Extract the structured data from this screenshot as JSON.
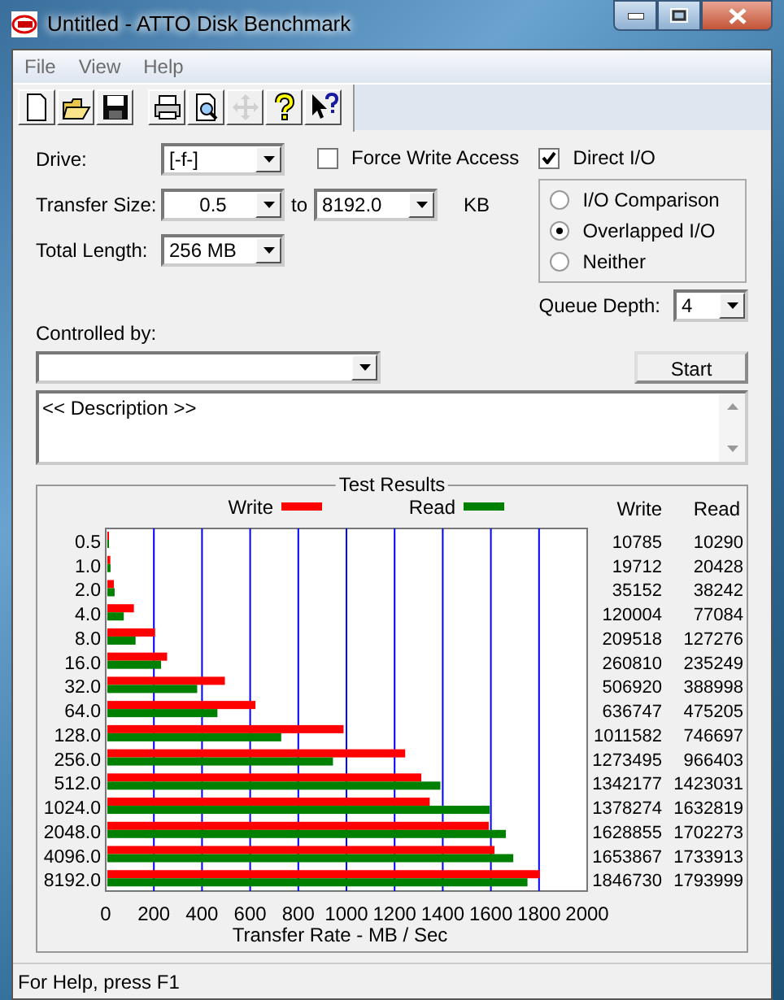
{
  "window": {
    "title": "Untitled - ATTO Disk Benchmark"
  },
  "menu": [
    {
      "label": "File"
    },
    {
      "label": "View"
    },
    {
      "label": "Help"
    }
  ],
  "toolbar": [
    {
      "kind": "new",
      "disabled": false
    },
    {
      "kind": "open",
      "disabled": false
    },
    {
      "kind": "save",
      "disabled": false
    },
    {
      "kind": "sep"
    },
    {
      "kind": "print",
      "disabled": false
    },
    {
      "kind": "preview",
      "disabled": false
    },
    {
      "kind": "move",
      "disabled": true
    },
    {
      "kind": "help",
      "disabled": false
    },
    {
      "kind": "context-help",
      "disabled": false
    }
  ],
  "form": {
    "drive": {
      "label": "Drive:",
      "value": "[-f-]"
    },
    "force_write_access": {
      "label": "Force Write Access",
      "checked": false
    },
    "direct_io": {
      "label": "Direct I/O",
      "checked": true
    },
    "transfer_size": {
      "label": "Transfer Size:",
      "from": "0.5",
      "to_label": "to",
      "to": "8192.0",
      "unit": "KB"
    },
    "total_length": {
      "label": "Total Length:",
      "value": "256 MB"
    },
    "io_modes": [
      {
        "label": "I/O Comparison",
        "selected": false
      },
      {
        "label": "Overlapped I/O",
        "selected": true
      },
      {
        "label": "Neither",
        "selected": false
      }
    ],
    "queue_depth": {
      "label": "Queue Depth:",
      "value": "4"
    },
    "controlled_by": {
      "label": "Controlled by:"
    },
    "start_button": "Start",
    "description": "<< Description >>"
  },
  "results": {
    "title": "Test Results",
    "chart_data": {
      "type": "bar",
      "orientation": "horizontal",
      "grid": true,
      "legend": "top",
      "xlabel": "Transfer Rate - MB / Sec",
      "xlim": [
        0,
        2000
      ],
      "xticks": [
        0,
        200,
        400,
        600,
        800,
        1000,
        1200,
        1400,
        1600,
        1800,
        2000
      ],
      "categories": [
        "0.5",
        "1.0",
        "2.0",
        "4.0",
        "8.0",
        "16.0",
        "32.0",
        "64.0",
        "128.0",
        "256.0",
        "512.0",
        "1024.0",
        "2048.0",
        "4096.0",
        "8192.0"
      ],
      "series": [
        {
          "name": "Write",
          "color": "#ff0000",
          "values": [
            11,
            19,
            34,
            117,
            205,
            255,
            495,
            622,
            988,
            1244,
            1311,
            1346,
            1591,
            1615,
            1803
          ]
        },
        {
          "name": "Read",
          "color": "#008000",
          "values": [
            10,
            20,
            37,
            75,
            124,
            230,
            380,
            464,
            729,
            944,
            1390,
            1595,
            1662,
            1693,
            1752
          ]
        }
      ]
    },
    "table": {
      "columns": [
        "Write",
        "Read"
      ],
      "rows": [
        [
          "10785",
          "10290"
        ],
        [
          "19712",
          "20428"
        ],
        [
          "35152",
          "38242"
        ],
        [
          "120004",
          "77084"
        ],
        [
          "209518",
          "127276"
        ],
        [
          "260810",
          "235249"
        ],
        [
          "506920",
          "388998"
        ],
        [
          "636747",
          "475205"
        ],
        [
          "1011582",
          "746697"
        ],
        [
          "1273495",
          "966403"
        ],
        [
          "1342177",
          "1423031"
        ],
        [
          "1378274",
          "1632819"
        ],
        [
          "1628855",
          "1702273"
        ],
        [
          "1653867",
          "1733913"
        ],
        [
          "1846730",
          "1793999"
        ]
      ]
    }
  },
  "status_bar": "For Help, press F1"
}
